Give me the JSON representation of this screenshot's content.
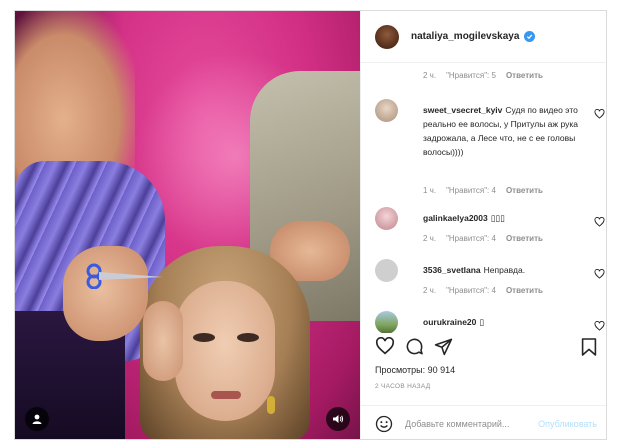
{
  "post": {
    "username": "nataliya_mogilevskaya",
    "verified": true
  },
  "top_meta": {
    "time": "2 ч.",
    "likes": "\"Нравится\": 5",
    "reply": "Ответить"
  },
  "comments": [
    {
      "username": "sweet_vsecret_kyiv",
      "text": "Судя по видео это реально ее волосы, у Притулы аж рука задрожала, а Лесе что, не с ее головы волосы))))",
      "time": "1 ч.",
      "likes": "\"Нравится\": 4",
      "reply": "Ответить"
    },
    {
      "username": "galinkaelya2003",
      "text": "▯▯▯",
      "time": "2 ч.",
      "likes": "\"Нравится\": 4",
      "reply": "Ответить"
    },
    {
      "username": "3536_svetlana",
      "text": "Неправда.",
      "time": "2 ч.",
      "likes": "\"Нравится\": 4",
      "reply": "Ответить"
    },
    {
      "username": "ourukraine20",
      "text": "▯"
    }
  ],
  "stats": {
    "views_label": "Просмотры:",
    "views_count": "90 914",
    "time_ago": "2 ЧАСОВ НАЗАД"
  },
  "add_comment": {
    "placeholder": "Добавьте комментарий...",
    "post_label": "Опубликовать"
  },
  "icons": {
    "like": "heart-icon",
    "comment": "comment-icon",
    "share": "share-icon",
    "save": "bookmark-icon",
    "emoji": "emoji-icon",
    "user_tag": "user-icon",
    "sound": "speaker-icon"
  }
}
